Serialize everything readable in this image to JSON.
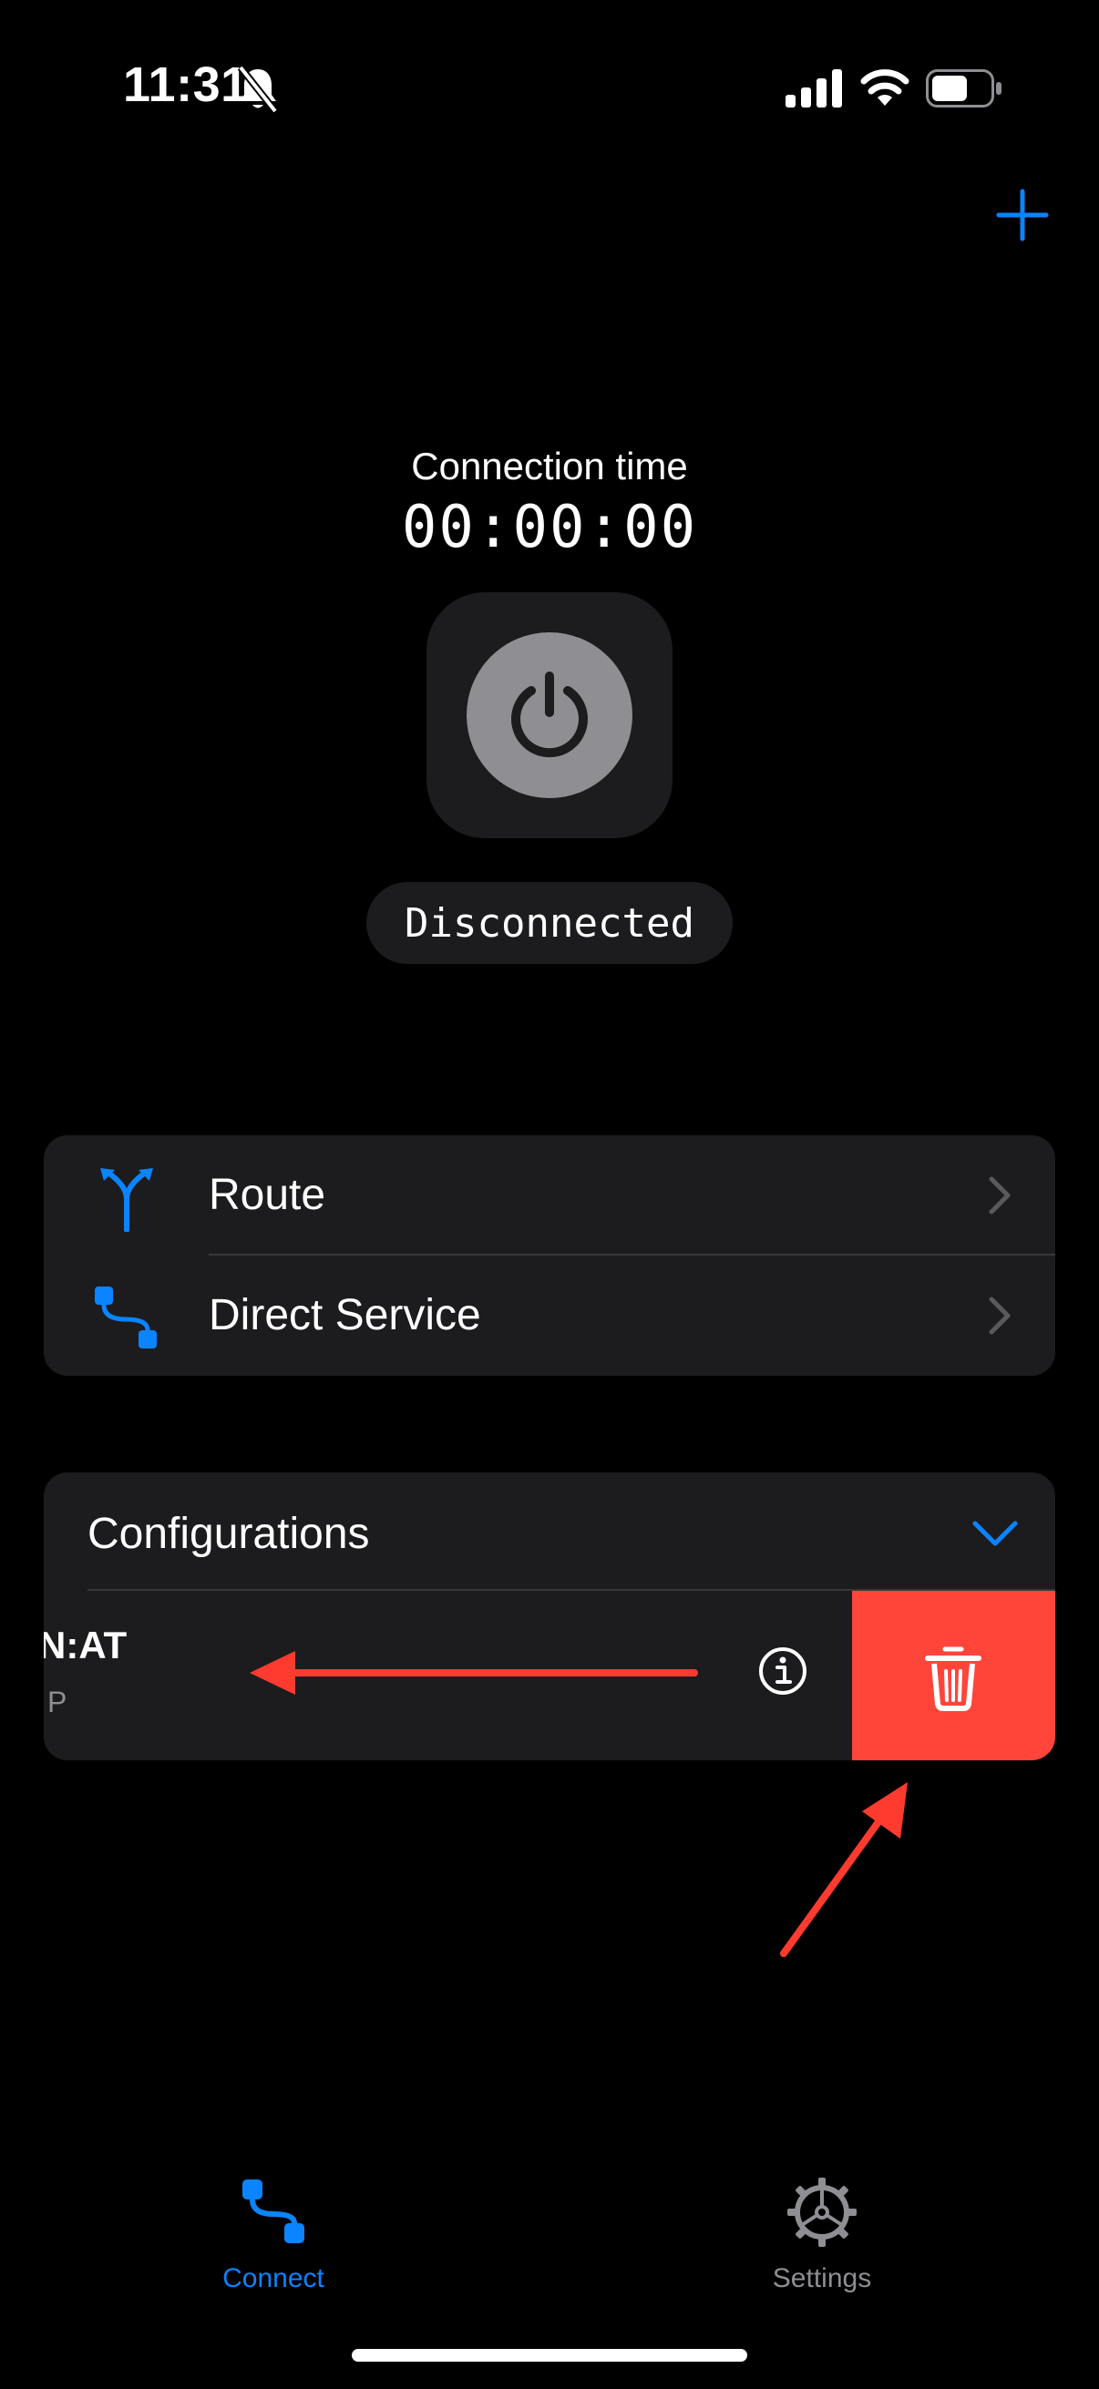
{
  "status_bar": {
    "time": "11:31"
  },
  "connection": {
    "label": "Connection time",
    "timer": "00:00:00",
    "state": "Disconnected"
  },
  "menu": {
    "items": [
      {
        "label": "Route",
        "icon": "route-fork-icon"
      },
      {
        "label": "Direct Service",
        "icon": "direct-service-icon"
      }
    ]
  },
  "configurations": {
    "title": "Configurations",
    "item": {
      "name": "N:AT",
      "subtitle": "P"
    },
    "delete_action_color": "#ff453a"
  },
  "tab_bar": {
    "tabs": [
      {
        "label": "Connect",
        "icon": "connect-icon",
        "active": true
      },
      {
        "label": "Settings",
        "icon": "gear-icon",
        "active": false
      }
    ]
  },
  "colors": {
    "accent": "#0a84ff",
    "background": "#000000",
    "card": "#1c1c1e",
    "destructive": "#ff453a",
    "annotation": "#ff3b30"
  }
}
